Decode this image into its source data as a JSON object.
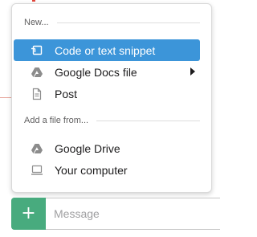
{
  "colors": {
    "accent_highlight": "#3c95d9",
    "plus_button": "#48ab7e",
    "divider": "#dddddd"
  },
  "menu": {
    "new_section": {
      "header": "New..."
    },
    "new_items": [
      {
        "label": "Code or text snippet",
        "icon": "snippet-icon",
        "active": true
      },
      {
        "label": "Google Docs file",
        "icon": "google-drive-icon",
        "has_submenu": true
      },
      {
        "label": "Post",
        "icon": "document-icon"
      }
    ],
    "add_section": {
      "header": "Add a file from..."
    },
    "add_items": [
      {
        "label": "Google Drive",
        "icon": "google-drive-icon"
      },
      {
        "label": "Your computer",
        "icon": "computer-icon"
      }
    ]
  },
  "composer": {
    "plus_label": "+",
    "placeholder": "Message",
    "value": ""
  }
}
